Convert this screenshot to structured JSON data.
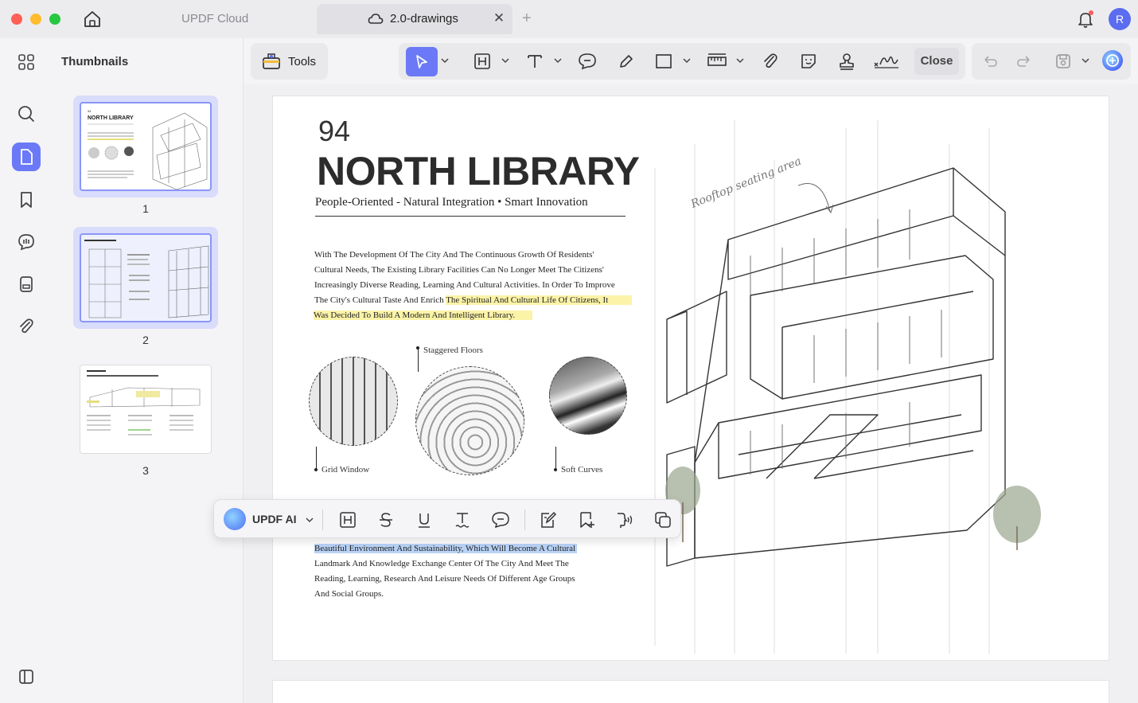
{
  "window": {
    "tabs": [
      {
        "label": "UPDF Cloud"
      },
      {
        "label": "2.0-drawings"
      }
    ],
    "user_initial": "R"
  },
  "sidebar": {
    "title": "Thumbnails",
    "rail_icons": [
      "thumbnails-icon",
      "search-icon",
      "pages-icon",
      "bookmark-icon",
      "comments-icon",
      "form-icon",
      "attachment-icon",
      "sidebar-toggle-icon"
    ],
    "pages": [
      {
        "num": "1"
      },
      {
        "num": "2"
      },
      {
        "num": "3"
      }
    ]
  },
  "toolbar": {
    "tools_label": "Tools",
    "close_label": "Close",
    "icons": [
      "select-icon",
      "text-box-icon",
      "text-icon",
      "comment-icon",
      "pencil-icon",
      "rectangle-icon",
      "measure-icon",
      "attach-icon",
      "sticker-icon",
      "stamp-icon",
      "signature-icon",
      "undo-icon",
      "redo-icon",
      "save-icon",
      "updf-ai-icon"
    ]
  },
  "document": {
    "page_number": "94",
    "title": "NORTH LIBRARY",
    "subtitle": "People-Oriented - Natural Integration • Smart Innovation",
    "paragraph1": [
      "With The Development Of The City And The Continuous Growth Of Residents'",
      "Cultural Needs, The Existing Library Facilities Can No Longer Meet The Citizens'",
      "Increasingly Diverse Reading, Learning And Cultural Activities. In Order To Improve",
      "The City's Cultural Taste And Enrich ",
      "The Spiritual And Cultural Life Of Citizens, It",
      "Was Decided To Build A Modern And Intelligent Library."
    ],
    "callouts": {
      "staggered": "Staggered Floors",
      "grid": "Grid Window",
      "soft": "Soft Curves",
      "rooftop": "Rooftop seating area"
    },
    "paragraph2": [
      "Beautiful Environment And Sustainability, Which Will Become A Cultural",
      "Landmark And Knowledge Exchange Center Of The City And Meet The",
      "Reading, Learning, Research And Leisure Needs Of Different Age Groups",
      "And Social Groups."
    ],
    "highlight_colors": {
      "yellow": "#fbf3a8",
      "blue": "#b9d3f6"
    }
  },
  "float_toolbar": {
    "ai_label": "UPDF AI",
    "icons": [
      "heading-icon",
      "strikethrough-icon",
      "underline-icon",
      "text-squiggle-icon",
      "comment-icon",
      "edit-note-icon",
      "bookmark-add-icon",
      "read-aloud-icon",
      "copy-icon"
    ]
  },
  "colors": {
    "accent": "#6b79f7",
    "chrome": "#f4f4f6"
  }
}
